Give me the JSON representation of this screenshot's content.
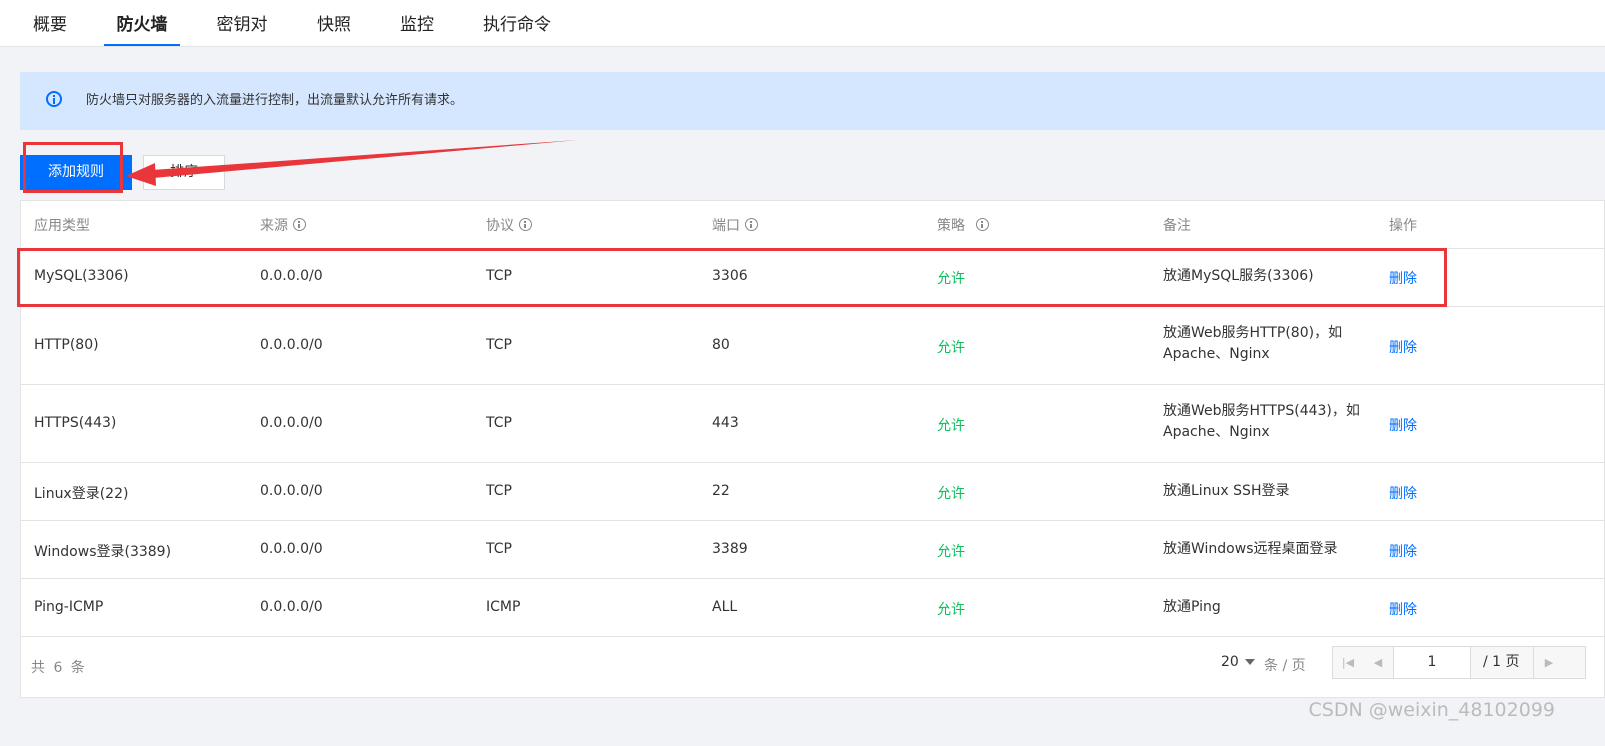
{
  "tabs": [
    {
      "label": "概要"
    },
    {
      "label": "防火墙"
    },
    {
      "label": "密钥对"
    },
    {
      "label": "快照"
    },
    {
      "label": "监控"
    },
    {
      "label": "执行命令"
    }
  ],
  "active_tab": "防火墙",
  "notice": {
    "text": "防火墙只对服务器的入流量进行控制，出流量默认允许所有请求。",
    "icon": "info-icon"
  },
  "toolbar": {
    "add_label": "添加规则",
    "sort_label": "排序"
  },
  "table": {
    "headers": [
      "应用类型",
      "来源",
      "协议",
      "端口",
      "策略",
      "备注",
      "操作"
    ],
    "rows": [
      {
        "type": "MySQL(3306)",
        "source": "0.0.0.0/0",
        "protocol": "TCP",
        "port": "3306",
        "policy": "允许",
        "note": "放通MySQL服务(3306)",
        "action": "删除"
      },
      {
        "type": "HTTP(80)",
        "source": "0.0.0.0/0",
        "protocol": "TCP",
        "port": "80",
        "policy": "允许",
        "note": "放通Web服务HTTP(80)，如Apache、Nginx",
        "action": "删除"
      },
      {
        "type": "HTTPS(443)",
        "source": "0.0.0.0/0",
        "protocol": "TCP",
        "port": "443",
        "policy": "允许",
        "note": "放通Web服务HTTPS(443)，如Apache、Nginx",
        "action": "删除"
      },
      {
        "type": "Linux登录(22)",
        "source": "0.0.0.0/0",
        "protocol": "TCP",
        "port": "22",
        "policy": "允许",
        "note": "放通Linux SSH登录",
        "action": "删除"
      },
      {
        "type": "Windows登录(3389)",
        "source": "0.0.0.0/0",
        "protocol": "TCP",
        "port": "3389",
        "policy": "允许",
        "note": "放通Windows远程桌面登录",
        "action": "删除"
      },
      {
        "type": "Ping-ICMP",
        "source": "0.0.0.0/0",
        "protocol": "ICMP",
        "port": "ALL",
        "policy": "允许",
        "note": "放通Ping",
        "action": "删除"
      }
    ]
  },
  "footer": {
    "total": "共 6 条",
    "page_size": "20",
    "per_page_label": "条 / 页",
    "current_page": "1",
    "total_pages": "/ 1 页"
  },
  "watermark": "CSDN @weixin_48102099",
  "colors": {
    "accent": "#006eff",
    "allow": "#0abf5b",
    "annotation": "#e8363b",
    "notice_bg": "#d5e7ff"
  }
}
